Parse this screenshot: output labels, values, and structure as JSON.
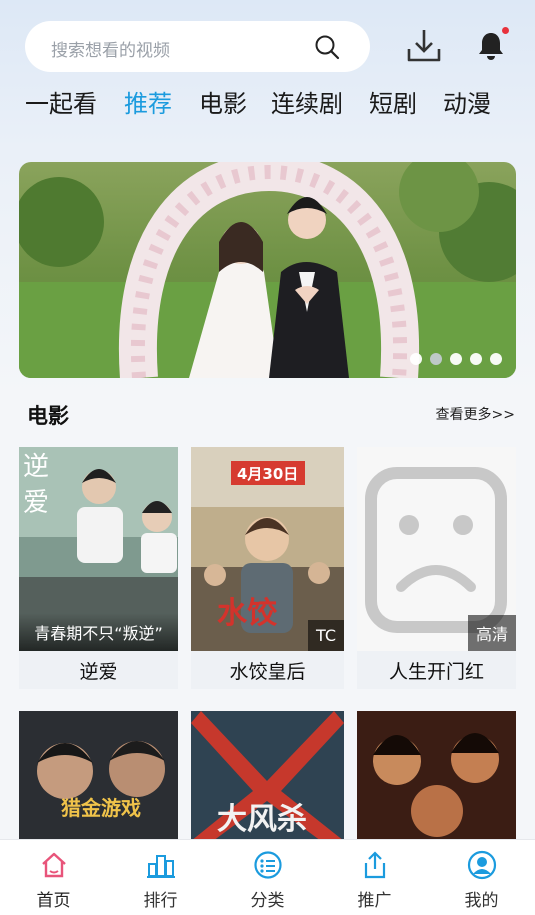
{
  "search": {
    "placeholder": "搜索想看的视频"
  },
  "header": {
    "download_icon": "download-icon",
    "bell_icon": "bell-icon",
    "notification_dot_color": "#e8323c"
  },
  "tabs": [
    {
      "label": "一起看",
      "active": false
    },
    {
      "label": "推荐",
      "active": true
    },
    {
      "label": "电影",
      "active": false
    },
    {
      "label": "连续剧",
      "active": false
    },
    {
      "label": "短剧",
      "active": false
    },
    {
      "label": "动漫",
      "active": false
    }
  ],
  "accent_color": "#1b9bde",
  "banner": {
    "slide_count": 5,
    "active_slide": 2
  },
  "section": {
    "title": "电影",
    "more_label": "查看更多>>"
  },
  "movies": [
    {
      "name": "逆爱",
      "badge": "青春期不只“叛逆”"
    },
    {
      "name": "水饺皇后",
      "badge": "TC"
    },
    {
      "name": "人生开门红",
      "badge": "高清"
    }
  ],
  "nav": [
    {
      "label": "首页",
      "icon": "home-icon",
      "active": true
    },
    {
      "label": "排行",
      "icon": "ranking-icon",
      "active": false
    },
    {
      "label": "分类",
      "icon": "category-icon",
      "active": false
    },
    {
      "label": "推广",
      "icon": "share-icon",
      "active": false
    },
    {
      "label": "我的",
      "icon": "profile-icon",
      "active": false
    }
  ],
  "nav_active_color": "#e8547a",
  "nav_icon_color": "#1b9bde"
}
